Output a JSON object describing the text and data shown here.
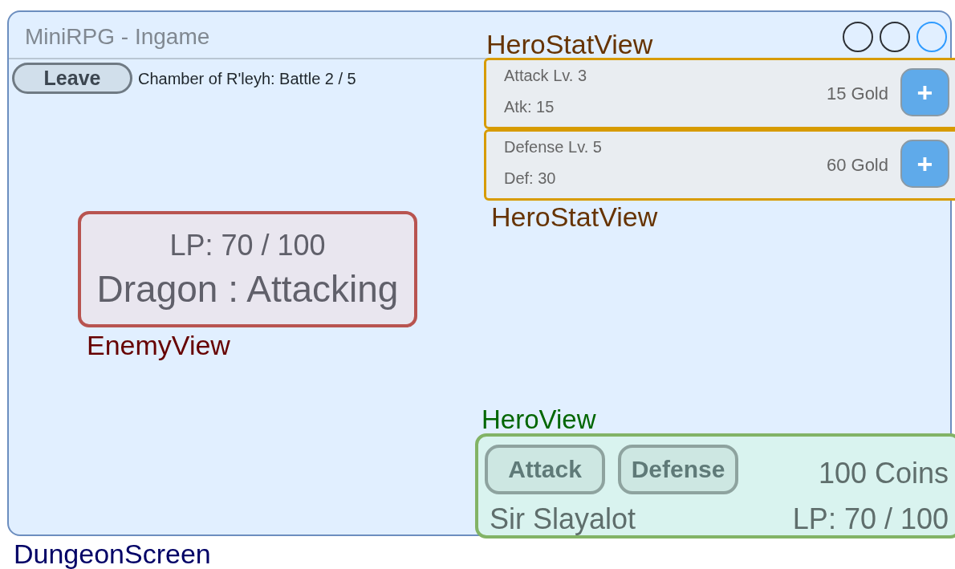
{
  "window": {
    "title": "MiniRPG - Ingame",
    "controls": [
      {
        "selected": false
      },
      {
        "selected": false
      },
      {
        "selected": true
      }
    ]
  },
  "toolbar": {
    "leave_button": "Leave",
    "location": "Chamber of R'leyh: Battle 2 / 5"
  },
  "hero_stats": [
    {
      "annotation": "HeroStatView",
      "name": "Attack Lv. 3",
      "value": "Atk: 15",
      "cost": "15 Gold",
      "button": "+"
    },
    {
      "annotation": "HeroStatView",
      "name": "Defense Lv. 5",
      "value": "Def: 30",
      "cost": "60 Gold",
      "button": "+"
    }
  ],
  "enemy": {
    "annotation": "EnemyView",
    "lp": "LP: 70 / 100",
    "status": "Dragon : Attacking"
  },
  "hero": {
    "annotation": "HeroView",
    "actions": [
      "Attack",
      "Defense"
    ],
    "coins": "100 Coins",
    "name": "Sir Slayalot",
    "lp": "LP: 70 / 100"
  },
  "screen_annotation": "DungeonScreen"
}
